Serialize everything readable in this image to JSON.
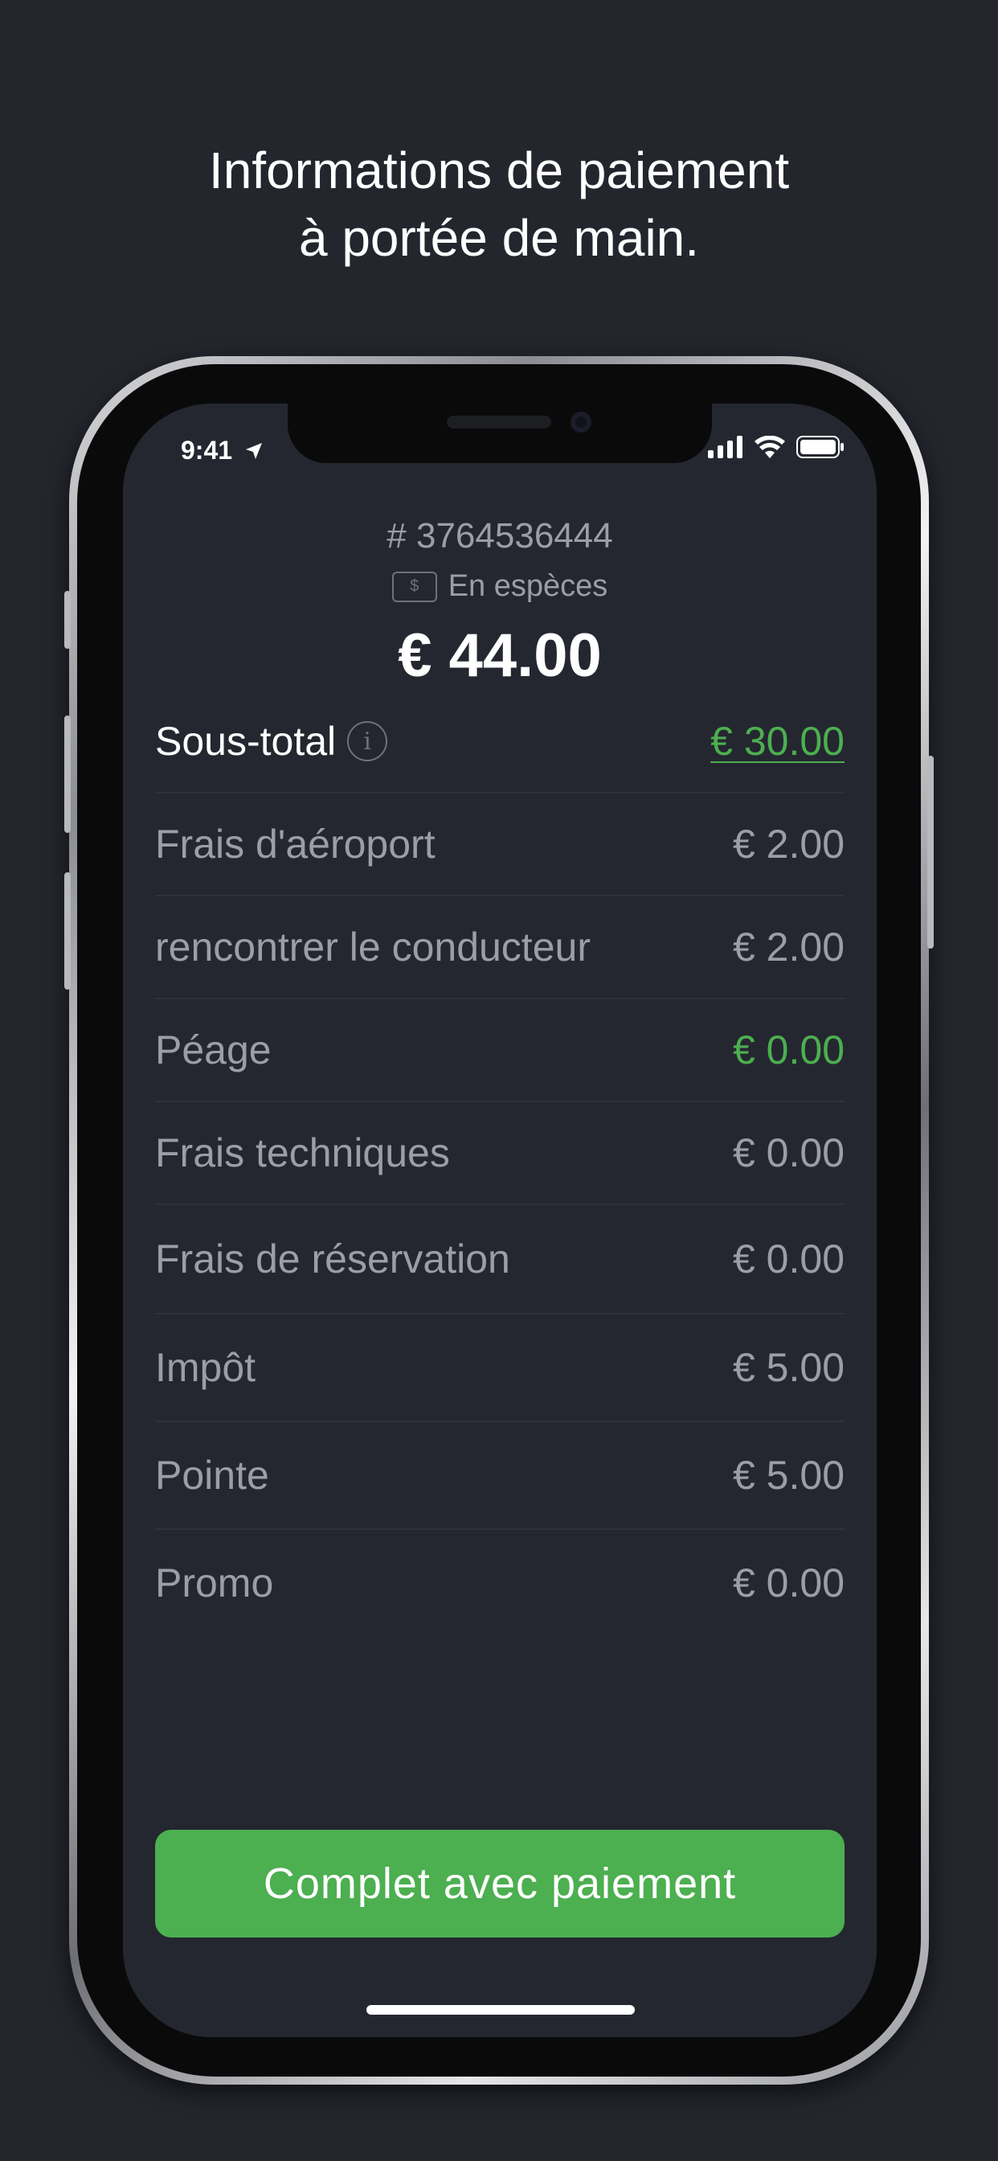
{
  "headline": {
    "line1": "Informations de paiement",
    "line2": "à portée de main."
  },
  "status_bar": {
    "time": "9:41",
    "icons": [
      "location-arrow-icon",
      "signal-icon",
      "wifi-icon",
      "battery-icon"
    ]
  },
  "order": {
    "id": "# 3764536444",
    "payment_method": "En espèces",
    "payment_icon_text": "$",
    "total": "€ 44.00"
  },
  "breakdown": [
    {
      "label": "Sous-total",
      "value": "€ 30.00"
    },
    {
      "label": "Frais d'aéroport",
      "value": "€ 2.00"
    },
    {
      "label": "rencontrer le conducteur",
      "value": "€ 2.00"
    },
    {
      "label": "Péage",
      "value": "€ 0.00"
    },
    {
      "label": "Frais techniques",
      "value": "€ 0.00"
    },
    {
      "label": "Frais de réservation",
      "value": "€ 0.00"
    },
    {
      "label": "Impôt",
      "value": "€ 5.00"
    },
    {
      "label": "Pointe",
      "value": "€ 5.00"
    },
    {
      "label": "Promo",
      "value": "€ 0.00"
    }
  ],
  "info_icon_text": "i",
  "cta_label": "Complet avec paiement",
  "colors": {
    "background": "#24262e",
    "accent_green": "#4caf50",
    "muted_text": "#9c9ea6"
  }
}
